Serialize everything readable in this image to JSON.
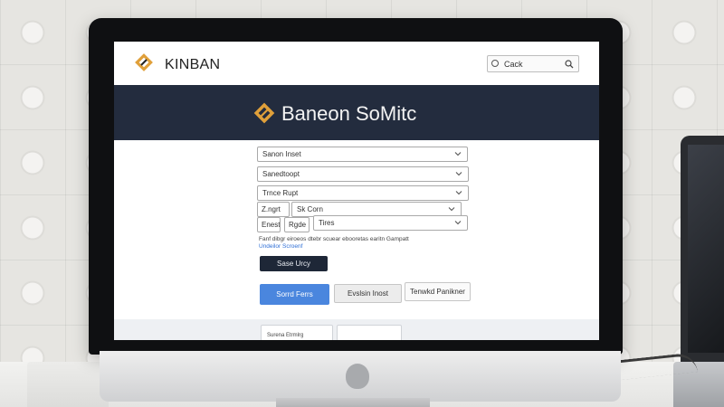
{
  "brand": {
    "name": "KINBAN",
    "logo_icon": "diamond-logo-icon",
    "accent_color": "#e0a03a"
  },
  "search": {
    "value": "Cack",
    "search_icon": "magnifier-icon"
  },
  "hero": {
    "title": "Baneon SoMitc",
    "background_color": "#232c3e"
  },
  "form": {
    "selects": [
      {
        "label": "Sanon Inset"
      },
      {
        "label": "Sanedtoopt"
      },
      {
        "label": "Trnce Rupt"
      }
    ],
    "row4": {
      "field_a": "Z.ngrt",
      "select_label": "Sk Corn"
    },
    "row5": {
      "field_a": "Enest",
      "field_b": "Rgde",
      "select_label": "Tires"
    },
    "helper_text": "Fanf dibgr eiroeos dtebr scuear ebooretas earitn Gampatt",
    "helper_link": "Undeilor Scroenf"
  },
  "buttons": {
    "primary_dark": "Sase Urcy",
    "primary_blue": "Sorrd Ferrs",
    "secondary_gray": "Evslsin Inost",
    "secondary_white": "Tenwkd Panikner"
  },
  "footer": {
    "card_left": "Surena Etrmlrg"
  }
}
